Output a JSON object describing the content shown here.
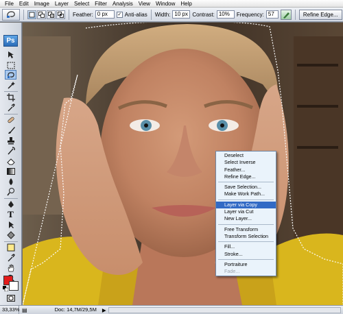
{
  "menu": [
    "File",
    "Edit",
    "Image",
    "Layer",
    "Select",
    "Filter",
    "Analysis",
    "View",
    "Window",
    "Help"
  ],
  "options": {
    "feather_label": "Feather:",
    "feather_value": "0 px",
    "antialias_label": "Anti-alias",
    "width_label": "Width:",
    "width_value": "10 px",
    "contrast_label": "Contrast:",
    "contrast_value": "10%",
    "frequency_label": "Frequency:",
    "frequency_value": "57",
    "refine_label": "Refine Edge..."
  },
  "toolbox": {
    "logo": "Ps",
    "colors": {
      "foreground": "#e31b1b",
      "background": "#ffffff"
    }
  },
  "context_menu": {
    "group1": [
      "Deselect",
      "Select Inverse",
      "Feather...",
      "Refine Edge..."
    ],
    "group2": [
      "Save Selection...",
      "Make Work Path..."
    ],
    "group3": [
      "Layer via Copy",
      "Layer via Cut",
      "New Layer..."
    ],
    "group4": [
      "Free Transform",
      "Transform Selection"
    ],
    "group5": [
      "Fill...",
      "Stroke..."
    ],
    "group6": [
      "Portraiture",
      "Fade..."
    ],
    "highlighted": "Layer via Copy",
    "disabled": "Fade..."
  },
  "status": {
    "zoom": "33,33%",
    "doc": "Doc: 14,7M/29,5M"
  }
}
